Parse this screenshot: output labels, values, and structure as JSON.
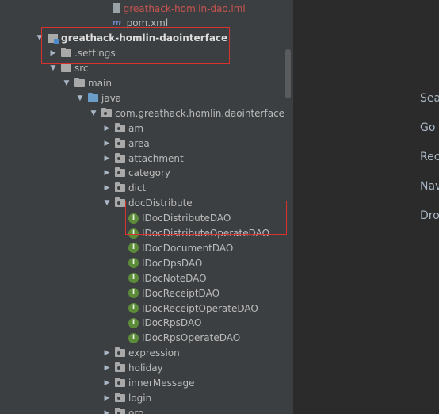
{
  "project_tree": {
    "rows": [
      {
        "depth": 4.8,
        "arrow": "none",
        "icon": "file",
        "label": "greathack-homlin-dao.iml",
        "style": "orange"
      },
      {
        "depth": 4.8,
        "arrow": "none",
        "icon": "maven",
        "label": "pom.xml",
        "style": ""
      },
      {
        "depth": 0,
        "arrow": "down",
        "icon": "module",
        "label": "greathack-homlin-daointerface",
        "style": "bold"
      },
      {
        "depth": 1,
        "arrow": "right",
        "icon": "folder",
        "label": ".settings",
        "style": ""
      },
      {
        "depth": 1,
        "arrow": "down",
        "icon": "folder",
        "label": "src",
        "style": ""
      },
      {
        "depth": 2,
        "arrow": "down",
        "icon": "folder",
        "label": "main",
        "style": ""
      },
      {
        "depth": 3,
        "arrow": "down",
        "icon": "folder-src",
        "label": "java",
        "style": ""
      },
      {
        "depth": 4,
        "arrow": "down",
        "icon": "package",
        "label": "com.greathack.homlin.daointerface",
        "style": ""
      },
      {
        "depth": 5,
        "arrow": "right",
        "icon": "package",
        "label": "am",
        "style": ""
      },
      {
        "depth": 5,
        "arrow": "right",
        "icon": "package",
        "label": "area",
        "style": ""
      },
      {
        "depth": 5,
        "arrow": "right",
        "icon": "package",
        "label": "attachment",
        "style": ""
      },
      {
        "depth": 5,
        "arrow": "right",
        "icon": "package",
        "label": "category",
        "style": ""
      },
      {
        "depth": 5,
        "arrow": "right",
        "icon": "package",
        "label": "dict",
        "style": ""
      },
      {
        "depth": 5,
        "arrow": "down",
        "icon": "package",
        "label": "docDistribute",
        "style": ""
      },
      {
        "depth": 6,
        "arrow": "none",
        "icon": "interface",
        "label": "IDocDistributeDAO",
        "style": ""
      },
      {
        "depth": 6,
        "arrow": "none",
        "icon": "interface",
        "label": "IDocDistributeOperateDAO",
        "style": ""
      },
      {
        "depth": 6,
        "arrow": "none",
        "icon": "interface",
        "label": "IDocDocumentDAO",
        "style": ""
      },
      {
        "depth": 6,
        "arrow": "none",
        "icon": "interface",
        "label": "IDocDpsDAO",
        "style": ""
      },
      {
        "depth": 6,
        "arrow": "none",
        "icon": "interface",
        "label": "IDocNoteDAO",
        "style": ""
      },
      {
        "depth": 6,
        "arrow": "none",
        "icon": "interface",
        "label": "IDocReceiptDAO",
        "style": ""
      },
      {
        "depth": 6,
        "arrow": "none",
        "icon": "interface",
        "label": "IDocReceiptOperateDAO",
        "style": ""
      },
      {
        "depth": 6,
        "arrow": "none",
        "icon": "interface",
        "label": "IDocRpsDAO",
        "style": ""
      },
      {
        "depth": 6,
        "arrow": "none",
        "icon": "interface",
        "label": "IDocRpsOperateDAO",
        "style": ""
      },
      {
        "depth": 5,
        "arrow": "right",
        "icon": "package",
        "label": "expression",
        "style": ""
      },
      {
        "depth": 5,
        "arrow": "right",
        "icon": "package",
        "label": "holiday",
        "style": ""
      },
      {
        "depth": 5,
        "arrow": "right",
        "icon": "package",
        "label": "innerMessage",
        "style": ""
      },
      {
        "depth": 5,
        "arrow": "right",
        "icon": "package",
        "label": "login",
        "style": ""
      },
      {
        "depth": 5,
        "arrow": "right",
        "icon": "package",
        "label": "org",
        "style": ""
      }
    ]
  },
  "editor_hints": {
    "items": [
      "Sea",
      "Go",
      "Rec",
      "Nav",
      "Dro"
    ]
  },
  "interface_badge": "I",
  "maven_badge": "m",
  "colors": {
    "tree_bg": "#3c3f41",
    "editor_bg": "#2b2b2b",
    "highlight_border": "#d9312e",
    "interface_icon": "#5c8c3a"
  }
}
